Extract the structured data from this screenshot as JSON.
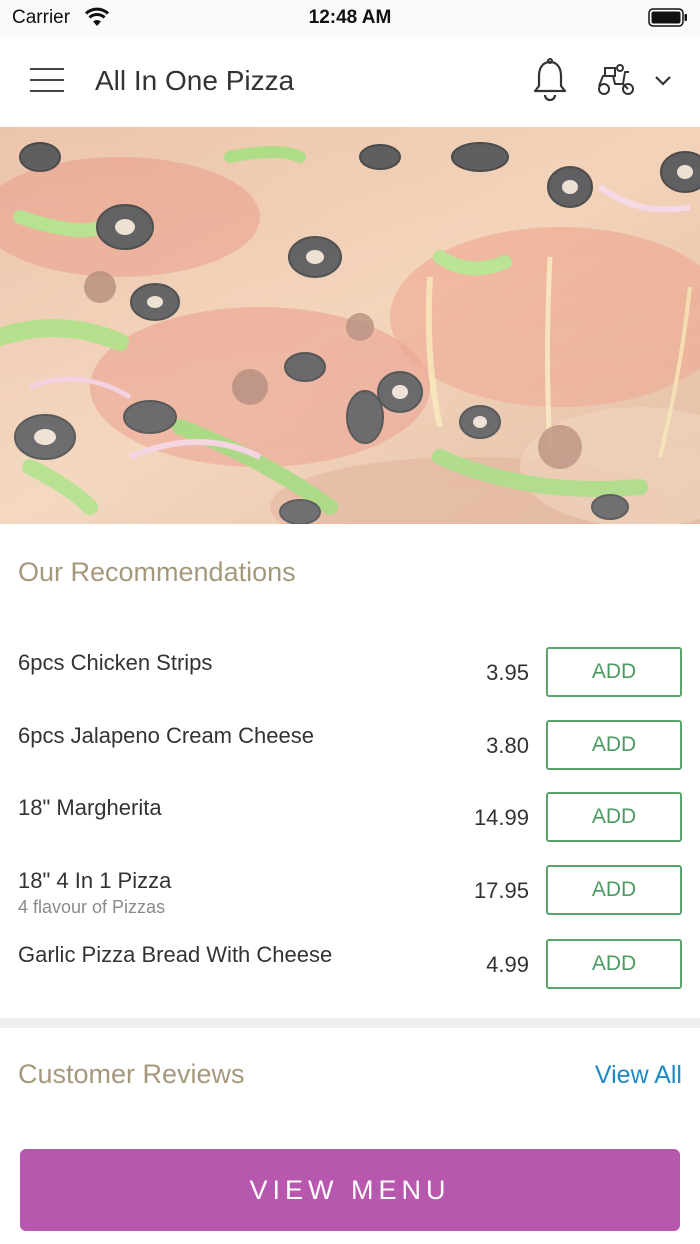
{
  "status_bar": {
    "carrier": "Carrier",
    "time": "12:48 AM"
  },
  "header": {
    "title": "All In One Pizza",
    "icons": [
      "menu-icon",
      "bell-icon",
      "delivery-scooter-icon",
      "chevron-down-icon"
    ]
  },
  "hero": {
    "image": "pizza-photo"
  },
  "recommendations": {
    "title": "Our Recommendations",
    "items": [
      {
        "name": "6pcs Chicken Strips",
        "description": "",
        "price": "3.95",
        "action": "ADD"
      },
      {
        "name": "6pcs Jalapeno Cream Cheese",
        "description": "",
        "price": "3.80",
        "action": "ADD"
      },
      {
        "name": "18\" Margherita",
        "description": "",
        "price": "14.99",
        "action": "ADD"
      },
      {
        "name": "18\" 4 In 1 Pizza",
        "description": "4 flavour of Pizzas",
        "price": "17.95",
        "action": "ADD"
      },
      {
        "name": "Garlic Pizza Bread With Cheese",
        "description": "",
        "price": "4.99",
        "action": "ADD"
      }
    ]
  },
  "reviews": {
    "title": "Customer Reviews",
    "view_all": "View All"
  },
  "footer": {
    "view_menu": "VIEW MENU"
  },
  "colors": {
    "accent_title": "#a6987c",
    "add_button": "#5aa56e",
    "link": "#1f8ac4",
    "primary_button": "#b757ae"
  }
}
